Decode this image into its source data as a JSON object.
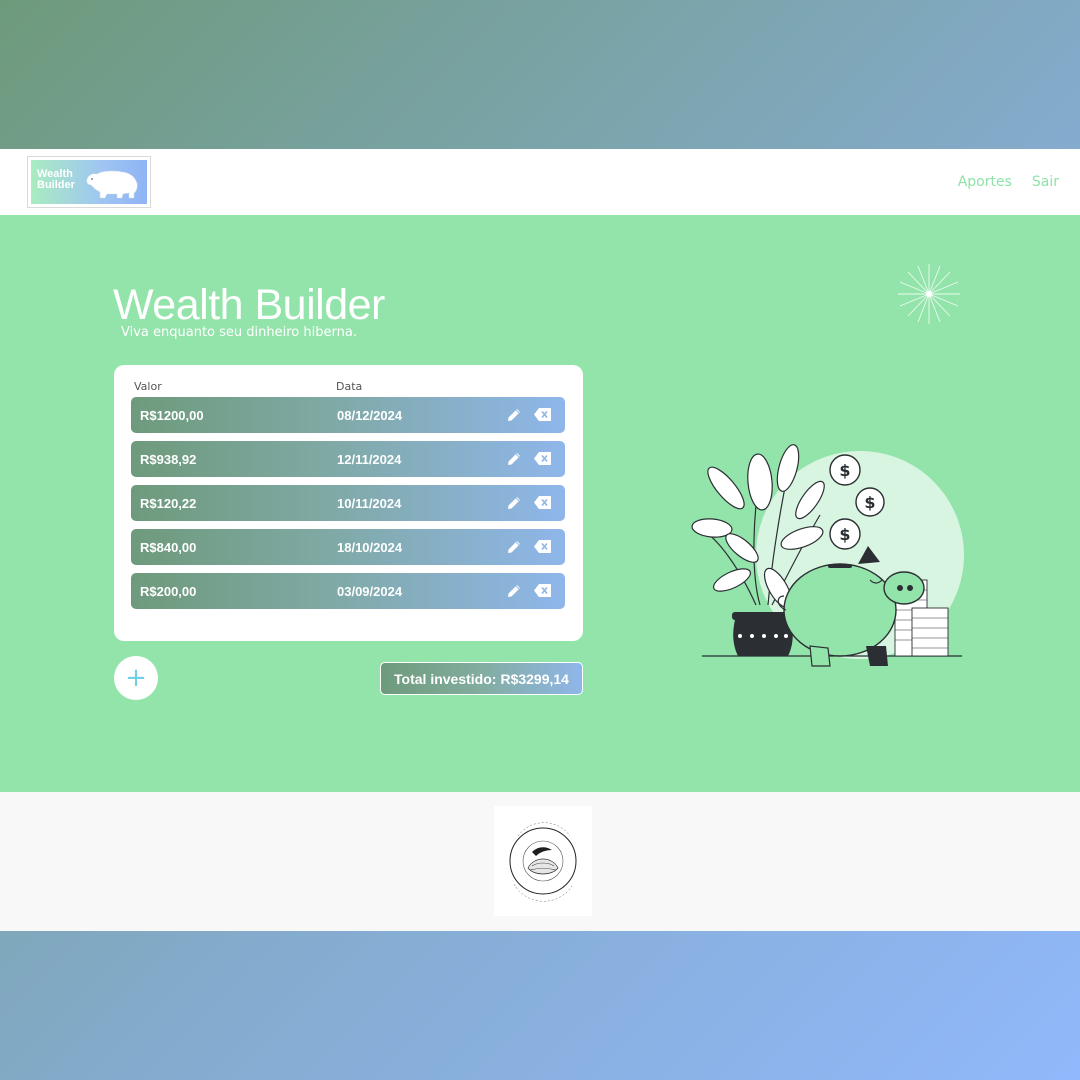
{
  "header": {
    "logo_text": "Wealth Builder",
    "nav": [
      {
        "label": "Aportes"
      },
      {
        "label": "Sair"
      }
    ]
  },
  "hero": {
    "title": "Wealth Builder",
    "subtitle": "Viva enquanto seu dinheiro hiberna."
  },
  "table": {
    "columns": [
      "Valor",
      "Data"
    ],
    "rows": [
      {
        "valor": "R$1200,00",
        "data": "08/12/2024"
      },
      {
        "valor": "R$938,92",
        "data": "12/11/2024"
      },
      {
        "valor": "R$120,22",
        "data": "10/11/2024"
      },
      {
        "valor": "R$840,00",
        "data": "18/10/2024"
      },
      {
        "valor": "R$200,00",
        "data": "03/09/2024"
      }
    ]
  },
  "actions": {
    "add_label": "+"
  },
  "summary": {
    "total_label": "Total investido:",
    "total_value": "R$3299,14"
  },
  "footer": {
    "badge_text": "CASTING SEEDS TO THE WIND · CAIOROSSI.DEV"
  },
  "colors": {
    "hero_bg": "#93e4aa",
    "accent_green": "#6e9a7c",
    "accent_blue": "#8fb6ea",
    "nav_link": "#8fe3a8",
    "add_icon": "#6fd0e6"
  }
}
